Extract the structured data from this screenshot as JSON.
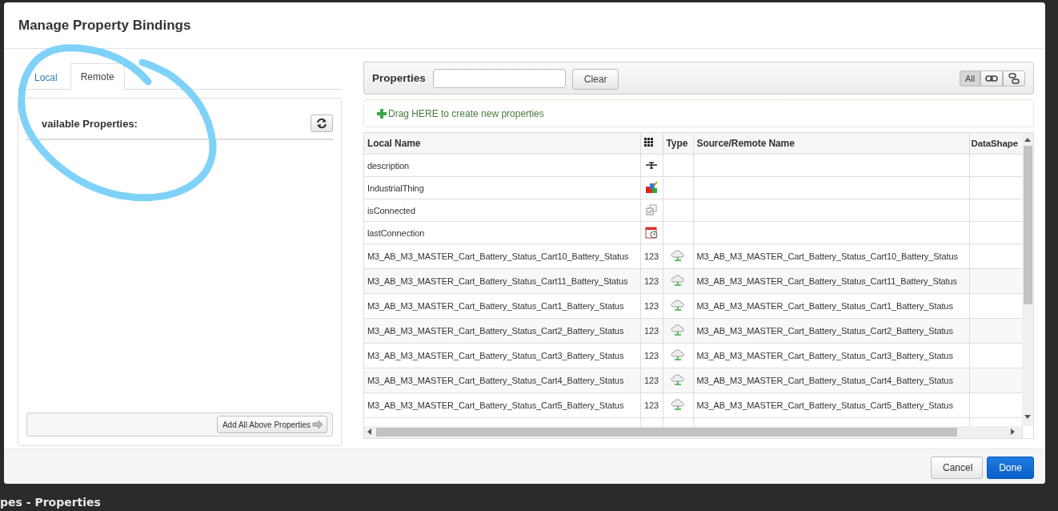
{
  "dialog": {
    "title": "Manage Property Bindings"
  },
  "tabs": [
    {
      "label": "Local",
      "selected": false
    },
    {
      "label": "Remote",
      "selected": true
    }
  ],
  "available_panel": {
    "heading": "vailable Properties:",
    "add_all_button": "Add All Above Properties"
  },
  "properties_toolbar": {
    "label": "Properties",
    "clear_button": "Clear",
    "filters": [
      {
        "kind": "text",
        "label": "All",
        "selected": true
      },
      {
        "kind": "link",
        "selected": false
      },
      {
        "kind": "unlink",
        "selected": false
      }
    ]
  },
  "drop_zone": {
    "text": "Drag HERE to create new properties"
  },
  "table": {
    "columns": [
      {
        "kind": "text",
        "label": "Local Name"
      },
      {
        "kind": "icon"
      },
      {
        "kind": "text",
        "label": "Type"
      },
      {
        "kind": "text",
        "label": "Source/Remote Name"
      },
      {
        "kind": "text",
        "label": "DataShape"
      }
    ],
    "rows": [
      {
        "local_name": "description",
        "base_type": {
          "kind": "string"
        },
        "remote_bound": false
      },
      {
        "local_name": "IndustrialThing",
        "base_type": {
          "kind": "thingname"
        },
        "remote_bound": false
      },
      {
        "local_name": "isConnected",
        "base_type": {
          "kind": "boolean"
        },
        "remote_bound": false
      },
      {
        "local_name": "lastConnection",
        "base_type": {
          "kind": "datetime"
        },
        "remote_bound": false
      },
      {
        "local_name": "M3_AB_M3_MASTER_Cart_Battery_Status_Cart10_Battery_Status",
        "base_type": {
          "kind": "number",
          "label": "123"
        },
        "remote_bound": true,
        "source_name": "M3_AB_M3_MASTER_Cart_Battery_Status_Cart10_Battery_Status"
      },
      {
        "local_name": "M3_AB_M3_MASTER_Cart_Battery_Status_Cart11_Battery_Status",
        "base_type": {
          "kind": "number",
          "label": "123"
        },
        "remote_bound": true,
        "source_name": "M3_AB_M3_MASTER_Cart_Battery_Status_Cart11_Battery_Status"
      },
      {
        "local_name": "M3_AB_M3_MASTER_Cart_Battery_Status_Cart1_Battery_Status",
        "base_type": {
          "kind": "number",
          "label": "123"
        },
        "remote_bound": true,
        "source_name": "M3_AB_M3_MASTER_Cart_Battery_Status_Cart1_Battery_Status"
      },
      {
        "local_name": "M3_AB_M3_MASTER_Cart_Battery_Status_Cart2_Battery_Status",
        "base_type": {
          "kind": "number",
          "label": "123"
        },
        "remote_bound": true,
        "source_name": "M3_AB_M3_MASTER_Cart_Battery_Status_Cart2_Battery_Status"
      },
      {
        "local_name": "M3_AB_M3_MASTER_Cart_Battery_Status_Cart3_Battery_Status",
        "base_type": {
          "kind": "number",
          "label": "123"
        },
        "remote_bound": true,
        "source_name": "M3_AB_M3_MASTER_Cart_Battery_Status_Cart3_Battery_Status"
      },
      {
        "local_name": "M3_AB_M3_MASTER_Cart_Battery_Status_Cart4_Battery_Status",
        "base_type": {
          "kind": "number",
          "label": "123"
        },
        "remote_bound": true,
        "source_name": "M3_AB_M3_MASTER_Cart_Battery_Status_Cart4_Battery_Status"
      },
      {
        "local_name": "M3_AB_M3_MASTER_Cart_Battery_Status_Cart5_Battery_Status",
        "base_type": {
          "kind": "number",
          "label": "123"
        },
        "remote_bound": true,
        "source_name": "M3_AB_M3_MASTER_Cart_Battery_Status_Cart5_Battery_Status"
      }
    ]
  },
  "footer_buttons": [
    {
      "kind": "secondary",
      "label": "Cancel"
    },
    {
      "kind": "primary",
      "label": "Done"
    }
  ],
  "background": {
    "heading_fragment": "pes - Properties"
  }
}
